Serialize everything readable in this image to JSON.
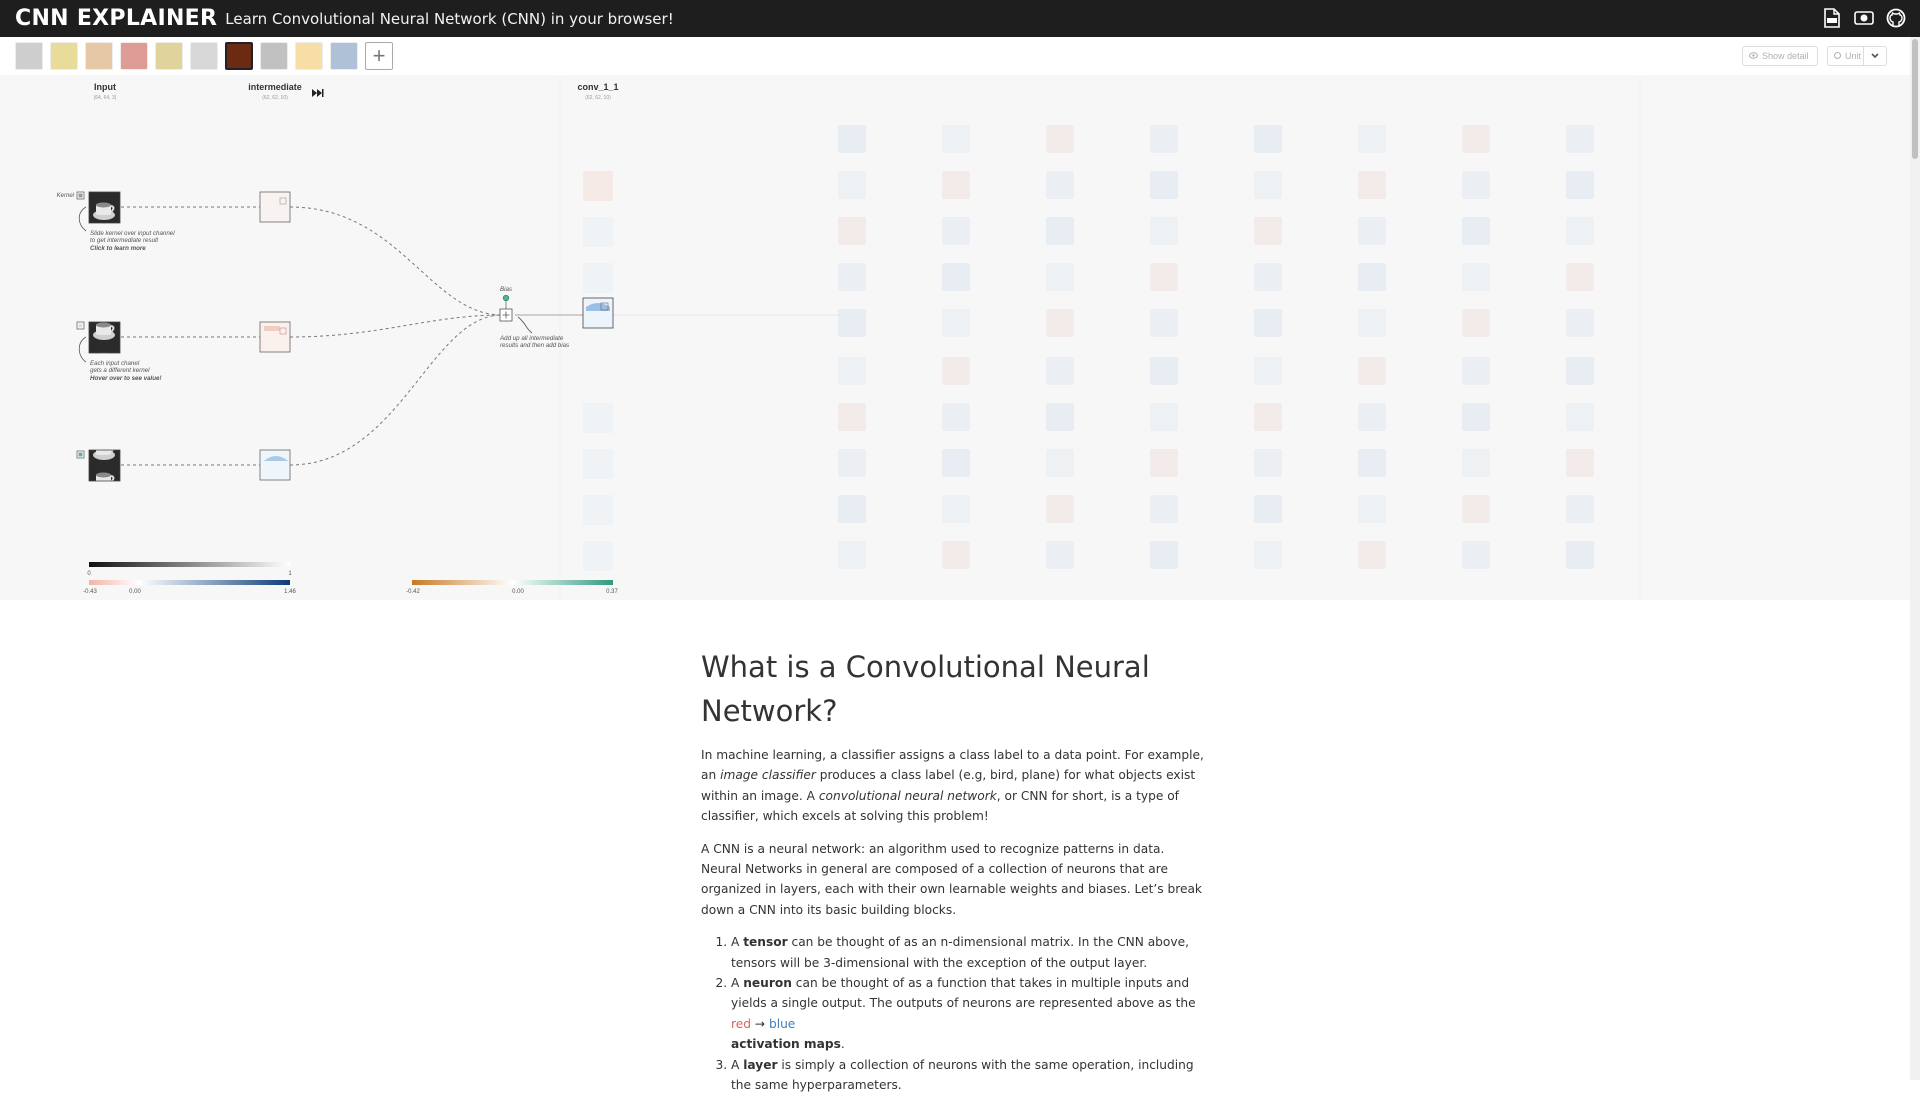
{
  "header": {
    "brand": "CNN EXPLAINER",
    "tagline": "Learn Convolutional Neural Network (CNN) in your browser!",
    "icons": [
      "pdf-icon",
      "video-icon",
      "github-icon"
    ]
  },
  "controls": {
    "images": [
      {
        "name": "thumbnail-1",
        "color": "#a7a7a7"
      },
      {
        "name": "thumbnail-2",
        "color": "#d8c04a"
      },
      {
        "name": "thumbnail-3",
        "color": "#d39a5e"
      },
      {
        "name": "thumbnail-4",
        "color": "#c54a3f"
      },
      {
        "name": "thumbnail-5",
        "color": "#c7b24d"
      },
      {
        "name": "thumbnail-6",
        "color": "#b9b9b9"
      },
      {
        "name": "thumbnail-7-espresso",
        "color": "#6b2a11"
      },
      {
        "name": "thumbnail-8",
        "color": "#8f8f8f"
      },
      {
        "name": "thumbnail-9",
        "color": "#f0c45a"
      },
      {
        "name": "thumbnail-10",
        "color": "#6f8fb5"
      }
    ],
    "add_symbol": "+",
    "show_detail": "Show detail",
    "unit": "Unit"
  },
  "overview": {
    "input_title": "Input",
    "input_dim": "(64, 64, 3)",
    "intermediate_title": "intermediate",
    "intermediate_dim": "(62, 62, 10)",
    "conv_title": "conv_1_1",
    "conv_dim": "(62, 62, 10)",
    "kernel_label": "Kernel",
    "bias_label": "Bias",
    "annotation_1": [
      "Slide kernel over input channel",
      "to get intermediate result",
      "Click to learn more"
    ],
    "annotation_2": [
      "Each input chanel",
      "gets a different kernel",
      "Hover over to see value!"
    ],
    "annotation_3": [
      "Add up all intermediate",
      "results and then add bias"
    ],
    "legend_input": {
      "min": "0",
      "max": "1"
    },
    "legend_intermediate": {
      "min": "-0.43",
      "mid": "0.00",
      "max": "1.46"
    },
    "legend_conv": {
      "min": "-0.42",
      "mid": "0.00",
      "max": "0.37"
    }
  },
  "article": {
    "title": "What is a Convolutional Neural Network?",
    "p1": {
      "t1": "In machine learning, a classifier assigns a class label to a data point. For example, an ",
      "em1": "image classifier",
      "t2": " produces a class label (e.g, bird, plane) for what objects exist within an image. A ",
      "em2": "convolutional neural network",
      "t3": ", or CNN for short, is a type of classifier, which excels at solving this problem!"
    },
    "p2": "A CNN is a neural network: an algorithm used to recognize patterns in data. Neural Networks in general are composed of a collection of neurons that are organized in layers, each with their own learnable weights and biases. Let’s break down a CNN into its basic building blocks.",
    "li1": {
      "b": "tensor",
      "t": " can be thought of as an n-dimensional matrix. In the CNN above, tensors will be 3-dimensional with the exception of the output layer."
    },
    "li2": {
      "b": "neuron",
      "t": " can be thought of as a function that takes in multiple inputs and yields a single output. The outputs of neurons are represented above as the ",
      "red": "red",
      "arrow": " → ",
      "blue": "blue",
      "b2": "activation maps",
      "end": "."
    },
    "li3": {
      "b": "layer",
      "t": " is simply a collection of neurons with the same operation, including the same hyperparameters."
    },
    "article_prefix": "A "
  }
}
